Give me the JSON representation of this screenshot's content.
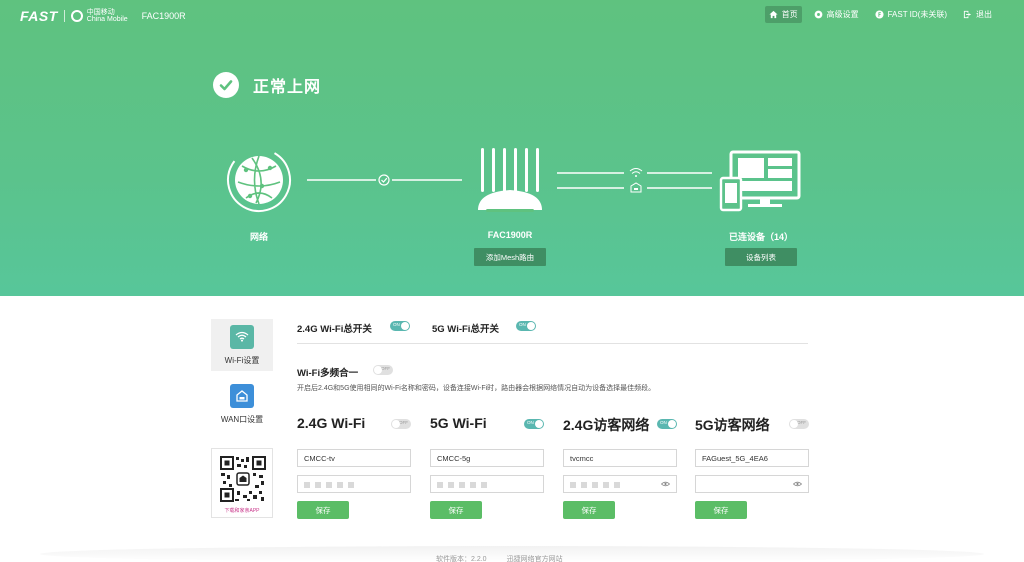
{
  "brand": {
    "logo": "FAST",
    "carrier_line1": "中国移动",
    "carrier_line2": "China Mobile",
    "model": "FAC1900R"
  },
  "nav": [
    {
      "label": "首页",
      "icon": "home-icon",
      "active": true
    },
    {
      "label": "高级设置",
      "icon": "gear-icon",
      "active": false
    },
    {
      "label": "FAST ID(未关联)",
      "icon": "fast-id-icon",
      "active": false
    },
    {
      "label": "退出",
      "icon": "logout-icon",
      "active": false
    }
  ],
  "status": {
    "text": "正常上网",
    "icon": "check-icon"
  },
  "topology": {
    "network_label": "网络",
    "router_label": "FAC1900R",
    "mesh_button": "添加Mesh路由",
    "devices_label": "已连设备（14）",
    "device_list_button": "设备列表"
  },
  "sidebar": [
    {
      "label": "Wi-Fi设置",
      "icon": "wifi-icon",
      "active": true
    },
    {
      "label": "WAN口设置",
      "icon": "wan-icon",
      "active": false
    }
  ],
  "qr": {
    "caption": "下载和家亲APP"
  },
  "master_switches": [
    {
      "label": "2.4G Wi-Fi总开关",
      "state": "on",
      "state_text": "ON"
    },
    {
      "label": "5G Wi-Fi总开关",
      "state": "on",
      "state_text": "ON"
    }
  ],
  "band_merge": {
    "label": "Wi-Fi多频合一",
    "state": "off",
    "state_text": "OFF",
    "description": "开启后2.4G和5G使用相同的Wi-Fi名称和密码，设备连接Wi-Fi时，路由器会根据网络情况自动为设备选择最佳频段。"
  },
  "bands": [
    {
      "title": "2.4G Wi-Fi",
      "state": "off",
      "state_text": "OFF",
      "ssid": "CMCC-tv",
      "show_eye": false,
      "save": "保存"
    },
    {
      "title": "5G Wi-Fi",
      "state": "on",
      "state_text": "ON",
      "ssid": "CMCC-5g",
      "show_eye": false,
      "save": "保存"
    },
    {
      "title": "2.4G访客网络",
      "state": "on",
      "state_text": "ON",
      "ssid": "tvcmcc",
      "show_eye": true,
      "save": "保存"
    },
    {
      "title": "5G访客网络",
      "state": "off",
      "state_text": "OFF",
      "ssid": "FAGuest_5G_4EA6",
      "show_eye": true,
      "save": "保存"
    }
  ],
  "footer": {
    "version": "软件版本：2.2.0",
    "link": "迅捷网络官方网站"
  },
  "colors": {
    "hero_green": "#5dc389",
    "accent_teal": "#5ab7b0",
    "save_green": "#5bbd66",
    "button_dark_green": "#3f8e63"
  }
}
